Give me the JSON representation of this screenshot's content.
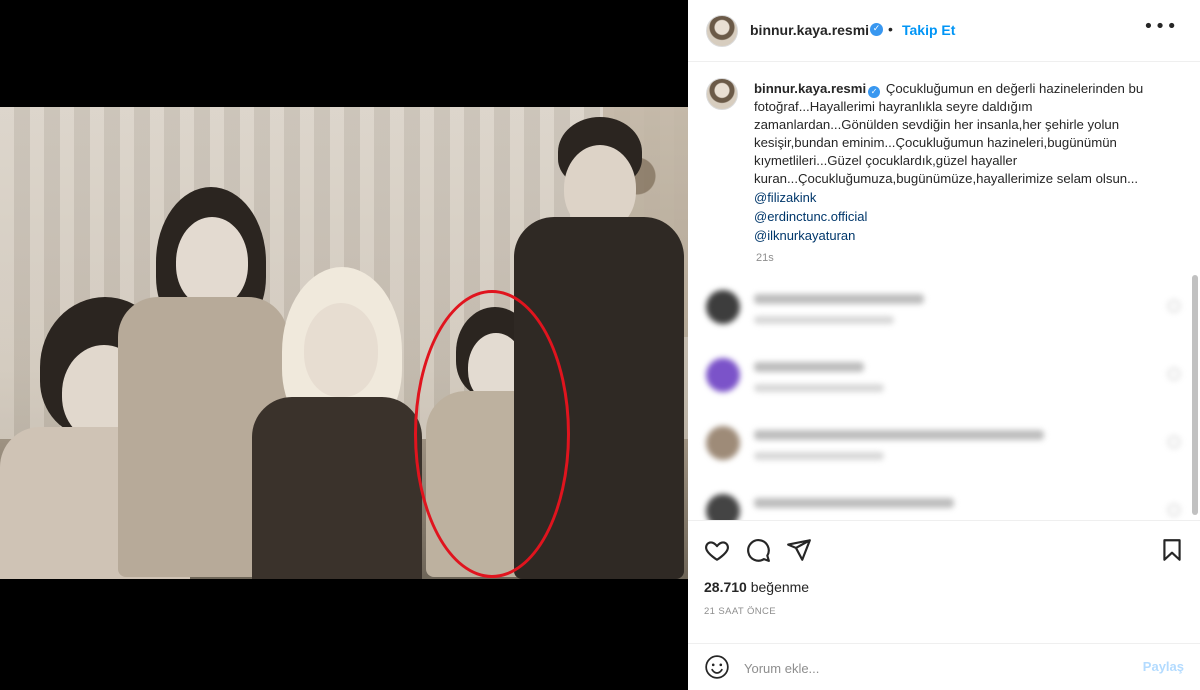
{
  "post": {
    "username": "binnur.kaya.resmi",
    "verified_glyph": "✓",
    "separator": "•",
    "follow_label": "Takip Et",
    "more_glyph": "•••"
  },
  "caption": {
    "username": "binnur.kaya.resmi",
    "text": "Çocukluğumun en değerli hazinelerinden bu fotoğraf...Hayallerimi hayranlıkla seyre daldığım zamanlardan...Gönülden sevdiğin her insanla,her şehirle yolun kesişir,bundan eminim...Çocukluğumun hazineleri,bugünümün kıymetlileri...Güzel çocuklardık,güzel hayaller kuran...Çocukluğumuza,bugünümüze,hayallerimize selam olsun...",
    "mentions": [
      "@filizakink",
      "@erdinctunc.official",
      "@ilknurkayaturan"
    ],
    "time_ago": "21s"
  },
  "comments_blurred": true,
  "actions": {
    "icons": [
      "heart-icon",
      "comment-icon",
      "share-icon",
      "bookmark-icon"
    ],
    "likes_count": "28.710",
    "likes_label": "beğenme",
    "posted_time": "21 SAAT ÖNCE"
  },
  "comment_box": {
    "emoji_icon": "emoji-icon",
    "placeholder": "Yorum ekle...",
    "submit_label": "Paylaş"
  },
  "colors": {
    "link_blue": "#0095f6",
    "mention_blue": "#00376b",
    "verified_blue": "#3897f0",
    "highlight_circle": "#e0141e",
    "disabled_submit": "#b3dbff"
  }
}
